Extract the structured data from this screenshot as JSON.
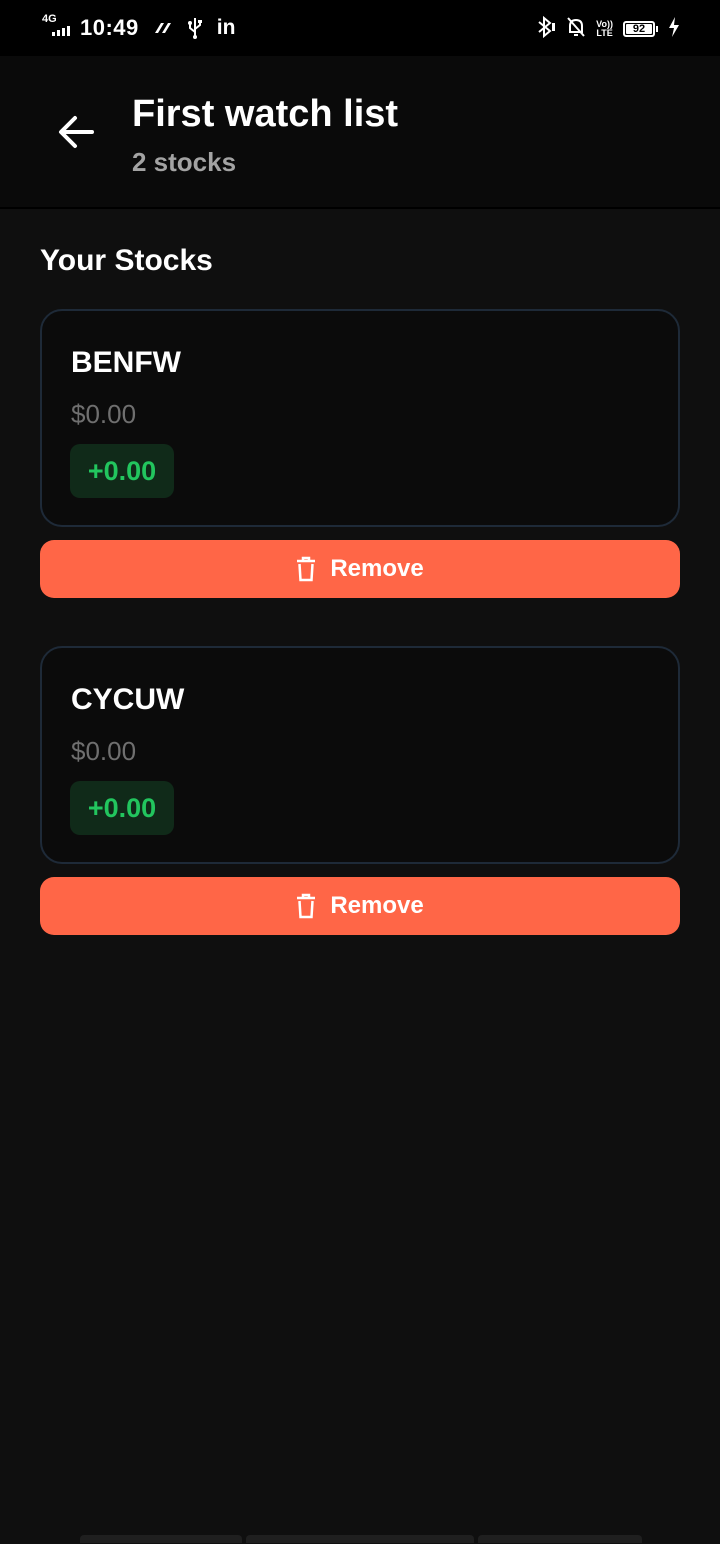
{
  "status_bar": {
    "network": "4G",
    "time": "10:49",
    "linkedin": "in",
    "volte_top": "Vo))",
    "volte_bottom": "LTE",
    "battery": "92"
  },
  "header": {
    "title": "First watch list",
    "subtitle": "2 stocks"
  },
  "section": {
    "title": "Your Stocks"
  },
  "stocks": [
    {
      "symbol": "BENFW",
      "price": "$0.00",
      "change": "+0.00",
      "remove_label": "Remove"
    },
    {
      "symbol": "CYCUW",
      "price": "$0.00",
      "change": "+0.00",
      "remove_label": "Remove"
    }
  ],
  "colors": {
    "background": "#0f0f0f",
    "accent_remove": "#ff6647",
    "positive": "#22c55e",
    "card_border": "#1e2a38"
  },
  "icons": {
    "back": "arrow-left-icon",
    "remove": "trash-icon"
  }
}
